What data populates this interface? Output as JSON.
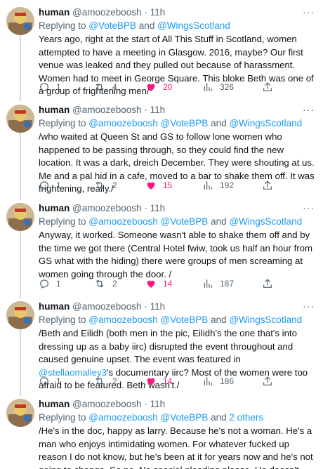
{
  "tweets": [
    {
      "name": "human",
      "handle": "@amoozeboosh",
      "dot": "·",
      "time": "11h",
      "reply_prefix": "Replying to ",
      "reply_to_1": "@VoteBPB",
      "reply_and": " and ",
      "reply_to_2": "@WingsScotland",
      "text": "Years ago, right at the start of All This Stuff in Scotland, women attempted to have a meeting in Glasgow. 2016, maybe? Our first venue was leaked and they pulled out because of harassment. Women had to meet in George Square. This bloke Beth was one of a group of frightening men/",
      "replies": "1",
      "retweets": "4",
      "likes": "20",
      "views": "326"
    },
    {
      "name": "human",
      "handle": "@amoozeboosh",
      "dot": "·",
      "time": "11h",
      "reply_prefix": "Replying to ",
      "reply_to_1": "@amoozeboosh @VoteBPB",
      "reply_and": " and ",
      "reply_to_2": "@WingsScotland",
      "text": "/who waited at Queen St and GS to follow lone women who happened to be passing through, so they could find the new location. It was a dark, dreich December. They were shouting at us. Me and a pal hid in a cafe, moved to a bar to shake them off. It was frightening, really./",
      "replies": "1",
      "retweets": "2",
      "likes": "15",
      "views": "192"
    },
    {
      "name": "human",
      "handle": "@amoozeboosh",
      "dot": "·",
      "time": "11h",
      "reply_prefix": "Replying to ",
      "reply_to_1": "@amoozeboosh @VoteBPB",
      "reply_and": " and ",
      "reply_to_2": "@WingsScotland",
      "text": "Anyway, it worked. Someone wasn't able to shake them off and by the time we got there (Central Hotel fwiw, took us half an hour from GS what with the hiding) there were groups of men screaming at women going through the door. /",
      "replies": "1",
      "retweets": "2",
      "likes": "14",
      "views": "187"
    },
    {
      "name": "human",
      "handle": "@amoozeboosh",
      "dot": "·",
      "time": "11h",
      "reply_prefix": "Replying to ",
      "reply_to_1": "@amoozeboosh @VoteBPB",
      "reply_and": " and ",
      "reply_to_2": "@WingsScotland",
      "text_a": "/Beth and Eilidh (both men in the pic, Eilidh's the one that's into dressing up as a baby iirc) disrupted the event throughout and caused genuine upset. The event was featured in ",
      "text_mention": "@stellaomalley3",
      "text_b": "'s documentary iirc? Most of the women were too afraid to be featured. Beth wasn't./",
      "replies": "1",
      "retweets": "2",
      "likes": "14",
      "views": "186"
    },
    {
      "name": "human",
      "handle": "@amoozeboosh",
      "dot": "·",
      "time": "11h",
      "reply_prefix": "Replying to ",
      "reply_to_1": "@amoozeboosh @VoteBPB",
      "reply_and": " and ",
      "reply_to_2": "2 others",
      "text": "/He's in the doc, happy as larry. Because he's not a woman. He's a man who enjoys intimidating women. For whatever fucked up reason I do not know, but he's been at it for years now and he's not going to change. So no. No special pleading please. He doesn't deserve it."
    }
  ],
  "more_label": "···",
  "colors": {
    "accent": "#1d9bf0",
    "like": "#f91880",
    "muted": "#536471",
    "thread": "#cfd9de"
  },
  "icons": [
    "reply-icon",
    "retweet-icon",
    "like-icon",
    "views-icon",
    "share-icon",
    "more-icon"
  ]
}
